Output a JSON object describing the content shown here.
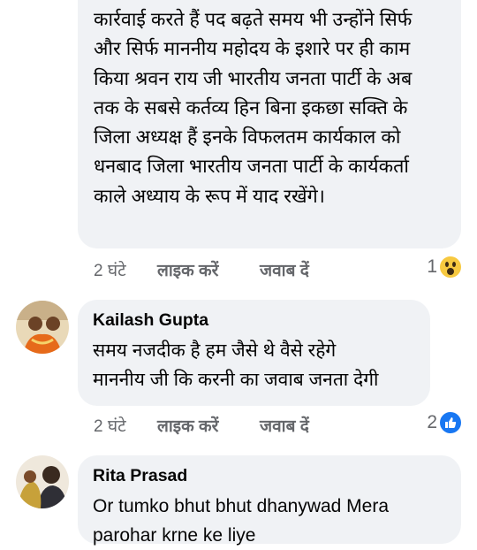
{
  "comments": [
    {
      "lines": [
        "कार्रवाई करते हैं पद बढ़ते समय भी उन्होंने सिर्फ",
        "और सिर्फ माननीय महोदय के इशारे पर ही काम",
        "किया श्रवन राय जी भारतीय जनता पार्टी के अब",
        "तक के सबसे कर्तव्य हिन बिना इकछा सक्ति के",
        "जिला अध्यक्ष हैं इनके विफलतम कार्यकाल को",
        "धनबाद जिला भारतीय जनता पार्टी के कार्यकर्ता",
        "काले अध्याय के रूप में याद रखेंगे।"
      ],
      "time": "2 घंटे",
      "like_label": "लाइक करें",
      "reply_label": "जवाब दें",
      "reaction_count": "1",
      "reaction_icon": "wow-reaction-icon"
    },
    {
      "author": "Kailash Gupta",
      "lines": [
        "समय नजदीक है हम जैसे थे वैसे रहेगे",
        "माननीय जी कि करनी का जवाब जनता देगी"
      ],
      "time": "2 घंटे",
      "like_label": "लाइक करें",
      "reply_label": "जवाब दें",
      "reaction_count": "2",
      "reaction_icon": "like-reaction-icon"
    },
    {
      "author": "Rita Prasad",
      "lines": [
        "Or tumko bhut bhut dhanywad Mera",
        "parohar krne ke liye"
      ]
    }
  ],
  "colors": {
    "bubble": "#f0f2f5",
    "meta_text": "#65676b",
    "like_blue": "#1877f2",
    "wow_yellow": "#f7c940"
  }
}
